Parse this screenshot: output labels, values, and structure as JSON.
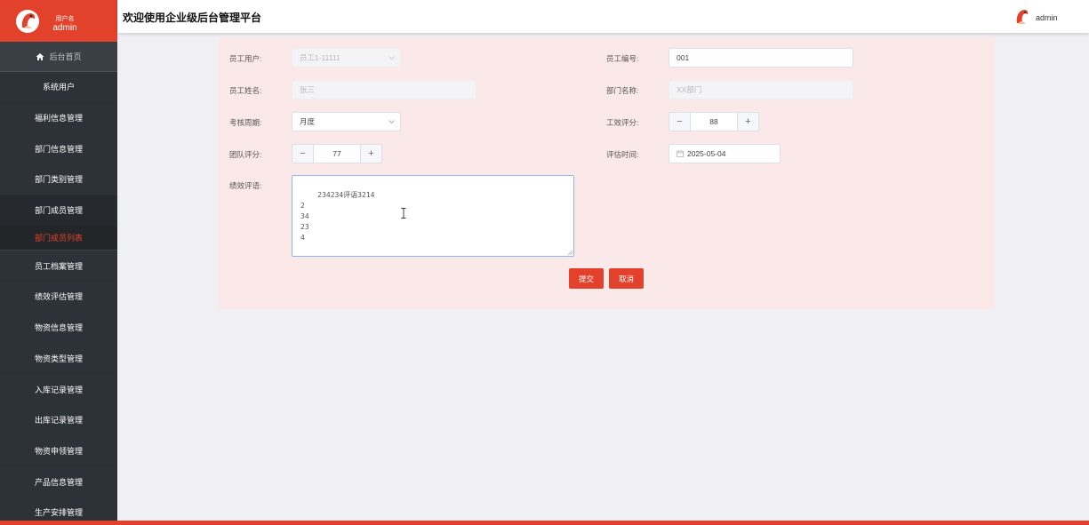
{
  "app": {
    "title": "欢迎使用企业级后台管理平台",
    "header_user": "admin",
    "brand_user_caption": "用户名",
    "brand_user_name": "admin",
    "accent_color": "#e2412b"
  },
  "sidebar": {
    "home": {
      "label": "后台首页",
      "icon": "home-icon"
    },
    "items": [
      {
        "label": "系统用户"
      },
      {
        "label": "福利信息管理"
      },
      {
        "label": "部门信息管理"
      },
      {
        "label": "部门类别管理"
      },
      {
        "label": "部门成员管理"
      }
    ],
    "active_sub": "部门成员列表",
    "items_after": [
      {
        "label": "员工档案管理"
      },
      {
        "label": "绩效评估管理"
      },
      {
        "label": "物资信息管理"
      },
      {
        "label": "物资类型管理"
      },
      {
        "label": "入库记录管理"
      },
      {
        "label": "出库记录管理"
      },
      {
        "label": "物资申领管理"
      },
      {
        "label": "产品信息管理"
      },
      {
        "label": "生产安排管理"
      }
    ]
  },
  "form": {
    "employee_user": {
      "label": "员工用户:",
      "value": "员工1-11111"
    },
    "employee_no": {
      "label": "员工编号:",
      "value": "001"
    },
    "employee_name": {
      "label": "员工姓名:",
      "value": "张三"
    },
    "dept_name": {
      "label": "部门名称:",
      "value": "XX部门"
    },
    "period": {
      "label": "考核周期:",
      "value": "月度"
    },
    "work_score": {
      "label": "工效评分:",
      "value": "88"
    },
    "team_score": {
      "label": "团队评分:",
      "value": "77"
    },
    "eval_time": {
      "label": "评估时间:",
      "value": "2025-05-04"
    },
    "comment": {
      "label": "绩效评语:",
      "value": "234234评语3214\n2\n34\n23\n4"
    },
    "submit_label": "提交",
    "cancel_label": "取消"
  }
}
